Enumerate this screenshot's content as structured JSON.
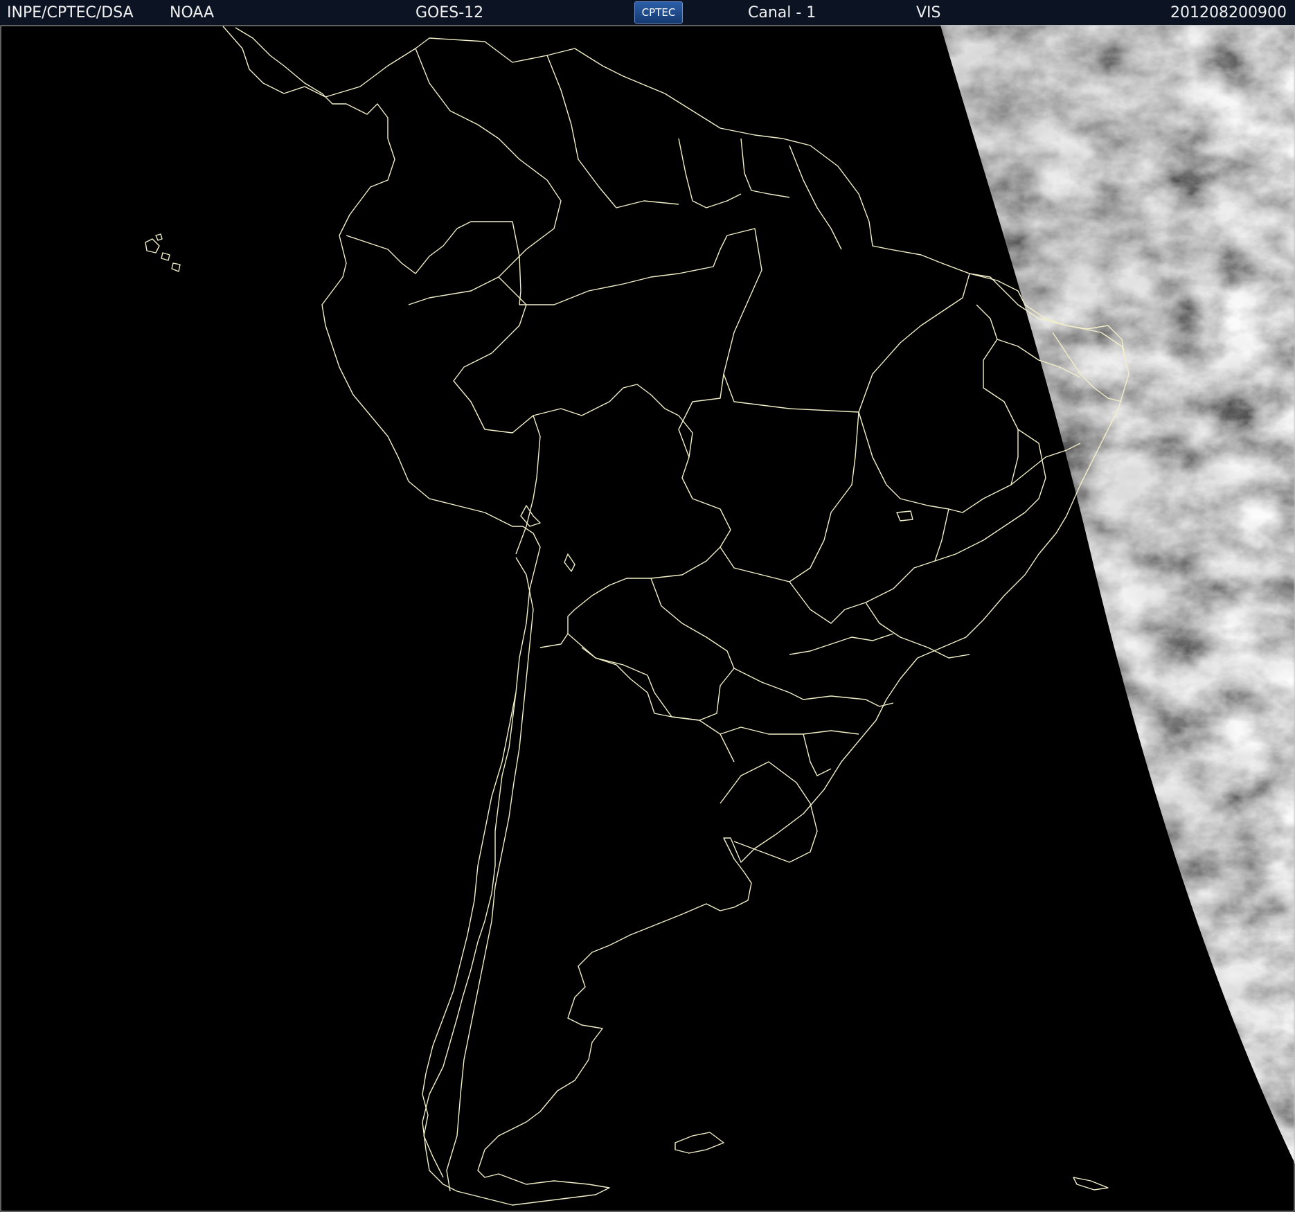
{
  "header": {
    "agency": "INPE/CPTEC/DSA",
    "source": "NOAA",
    "satellite": "GOES-12",
    "logo_text": "CPTEC",
    "channel": "Canal - 1",
    "band": "VIS",
    "timestamp": "201208200900"
  },
  "colors": {
    "background": "#000000",
    "header_bg": "#0c1424",
    "border_lines": "#f2efc8",
    "cloud_dark": "#4a4a4a",
    "cloud_light": "#e8e8e8"
  }
}
